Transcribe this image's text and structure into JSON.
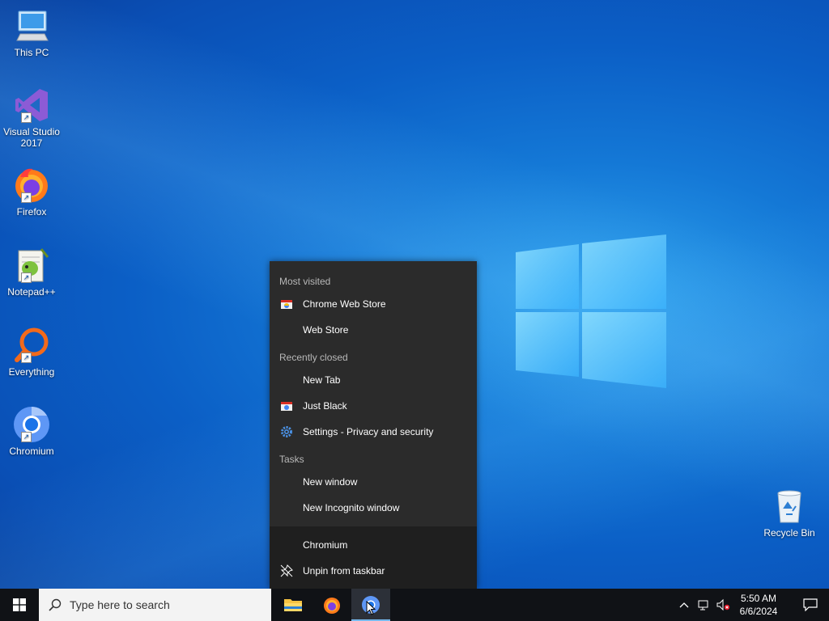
{
  "desktop": {
    "icons": [
      {
        "label": "This PC",
        "icon": "computer-icon"
      },
      {
        "label": "Visual Studio 2017",
        "icon": "visual-studio-icon"
      },
      {
        "label": "Firefox",
        "icon": "firefox-icon"
      },
      {
        "label": "Notepad++",
        "icon": "notepad-plus-plus-icon"
      },
      {
        "label": "Everything",
        "icon": "everything-search-icon"
      },
      {
        "label": "Chromium",
        "icon": "chromium-icon"
      },
      {
        "label": "Recycle Bin",
        "icon": "recycle-bin-icon"
      }
    ]
  },
  "jumplist": {
    "most_visited_header": "Most visited",
    "most_visited": [
      {
        "label": "Chrome Web Store",
        "icon": "chrome-web-store-icon"
      },
      {
        "label": "Web Store",
        "icon": ""
      }
    ],
    "recently_closed_header": "Recently closed",
    "recently_closed": [
      {
        "label": "New Tab",
        "icon": ""
      },
      {
        "label": "Just Black",
        "icon": "theme-icon"
      },
      {
        "label": "Settings - Privacy and security",
        "icon": "gear-icon"
      }
    ],
    "tasks_header": "Tasks",
    "tasks": [
      {
        "label": "New window"
      },
      {
        "label": "New Incognito window"
      }
    ],
    "app_label": "Chromium",
    "unpin_label": "Unpin from taskbar"
  },
  "taskbar": {
    "search_placeholder": "Type here to search",
    "apps": [
      "file-explorer-icon",
      "firefox-icon",
      "chromium-icon"
    ],
    "clock_time": "5:50 AM",
    "clock_date": "6/6/2024"
  },
  "colors": {
    "jumplist_bg": "#2b2b2b",
    "taskbar_bg": "#101216",
    "accent": "#76b9ed"
  }
}
